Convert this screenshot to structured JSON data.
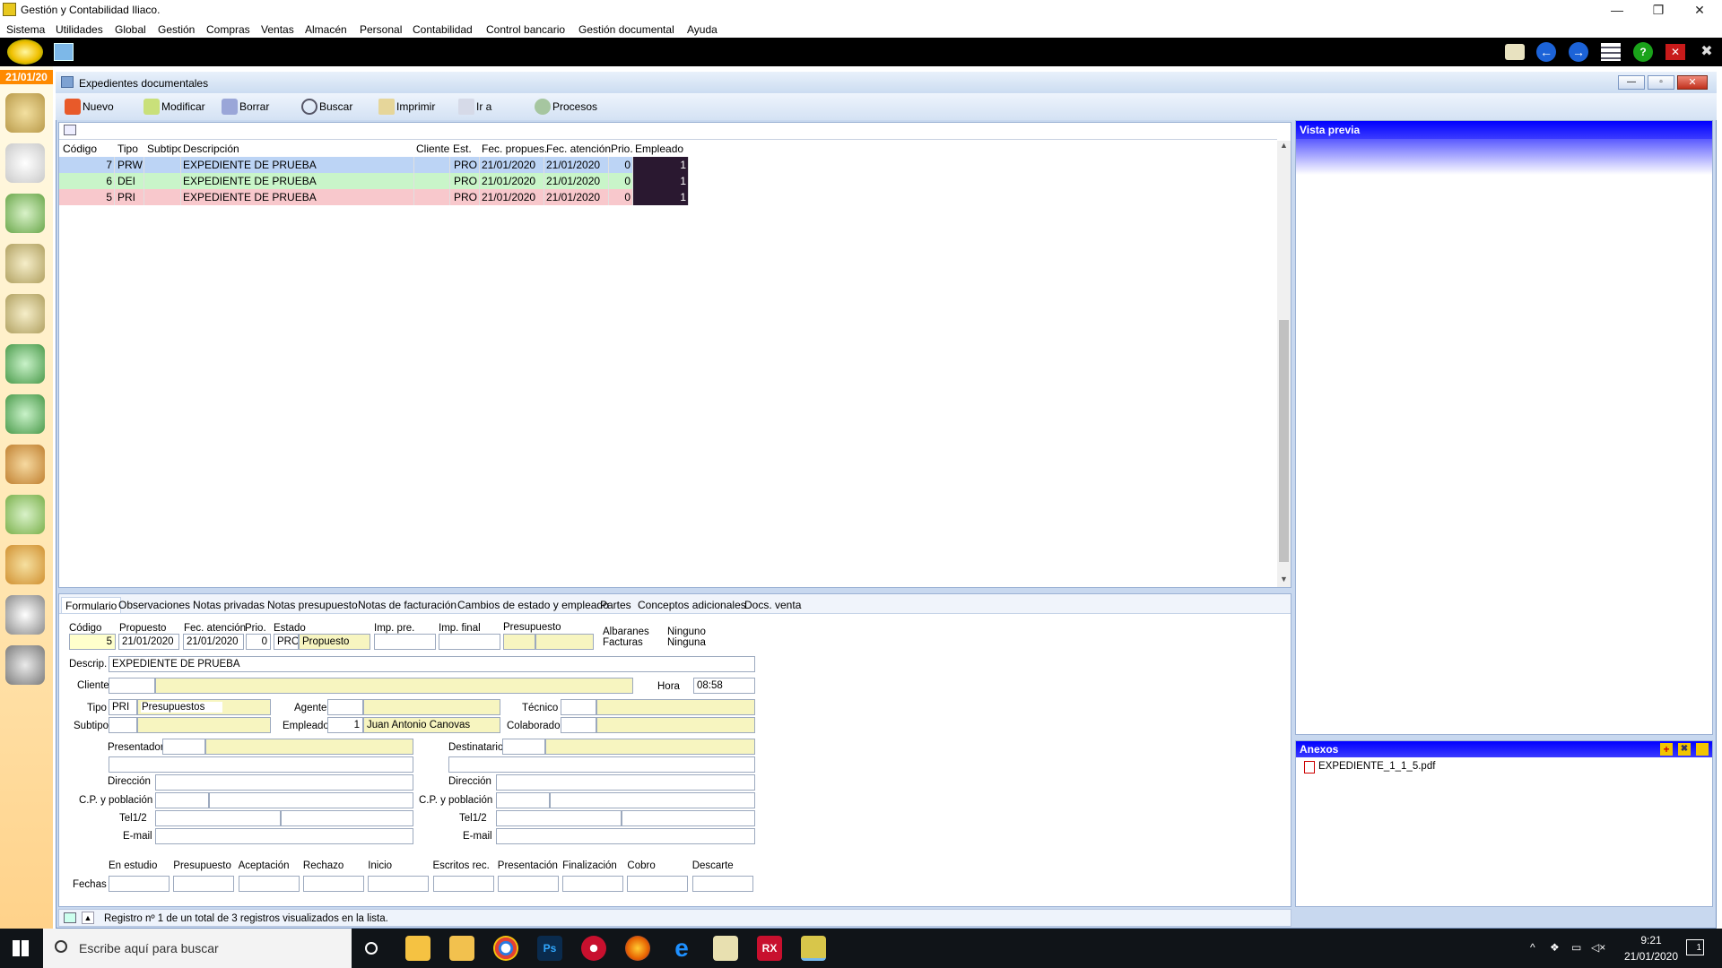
{
  "app": {
    "title": "Gestión y Contabilidad Iliaco.",
    "date_chip": "21/01/20",
    "menu": [
      "Sistema",
      "Utilidades",
      "Global",
      "Gestión",
      "Compras",
      "Ventas",
      "Almacén",
      "Personal",
      "Contabilidad",
      "Control bancario",
      "Gestión documental",
      "Ayuda"
    ]
  },
  "window": {
    "title": "Expedientes documentales",
    "toolbar": [
      "Nuevo",
      "Modificar",
      "Borrar",
      "Buscar",
      "Imprimir",
      "Ir a",
      "Procesos"
    ]
  },
  "grid": {
    "headers": [
      "Código",
      "Tipo",
      "Subtipo",
      "Descripción",
      "Cliente",
      "Est.",
      "Fec. propues.",
      "Fec. atención",
      "Prio.",
      "Empleado"
    ],
    "rows": [
      {
        "codigo": "7",
        "tipo": "PRW",
        "subtipo": "",
        "descripcion": "EXPEDIENTE DE PRUEBA",
        "cliente": "",
        "est": "PRO",
        "fec_prop": "21/01/2020",
        "fec_aten": "21/01/2020",
        "prio": "0",
        "empleado": "1",
        "color": "#bcd4f5"
      },
      {
        "codigo": "6",
        "tipo": "DEI",
        "subtipo": "",
        "descripcion": "EXPEDIENTE DE PRUEBA",
        "cliente": "",
        "est": "PRO",
        "fec_prop": "21/01/2020",
        "fec_aten": "21/01/2020",
        "prio": "0",
        "empleado": "1",
        "color": "#c9f5c9"
      },
      {
        "codigo": "5",
        "tipo": "PRI",
        "subtipo": "",
        "descripcion": "EXPEDIENTE DE PRUEBA",
        "cliente": "",
        "est": "PRO",
        "fec_prop": "21/01/2020",
        "fec_aten": "21/01/2020",
        "prio": "0",
        "empleado": "1",
        "color": "#f8c8cc"
      }
    ]
  },
  "preview": {
    "title": "Vista previa"
  },
  "anexos": {
    "title": "Anexos",
    "files": [
      "EXPEDIENTE_1_1_5.pdf"
    ]
  },
  "tabs": [
    "Formulario",
    "Observaciones",
    "Notas privadas",
    "Notas presupuesto",
    "Notas de facturación",
    "Cambios de estado y empleado",
    "Partes",
    "Conceptos adicionales",
    "Docs. venta"
  ],
  "form": {
    "l_codigo": "Código",
    "l_propuesto": "Propuesto",
    "l_fec_aten": "Fec. atención",
    "l_prio": "Prio.",
    "l_estado": "Estado",
    "l_imp_pre": "Imp. pre.",
    "l_imp_final": "Imp. final",
    "l_presupuesto": "Presupuesto",
    "l_albaranes": "Albaranes",
    "l_facturas": "Facturas",
    "albaranes": "Ninguno",
    "facturas": "Ninguna",
    "codigo": "5",
    "propuesto": "21/01/2020",
    "fec_aten": "21/01/2020",
    "prio": "0",
    "estado_code": "PRO",
    "estado": "Propuesto",
    "l_descrip": "Descrip.",
    "descrip": "EXPEDIENTE DE PRUEBA",
    "l_cliente": "Cliente",
    "l_hora": "Hora",
    "hora": "08:58",
    "l_tipo": "Tipo",
    "tipo_code": "PRI",
    "tipo": "Presupuestos",
    "l_agente": "Agente",
    "l_tecnico": "Técnico",
    "l_subtipo": "Subtipo",
    "l_empleado": "Empleado",
    "empleado_code": "1",
    "empleado": "Juan Antonio Canovas",
    "l_colaborador": "Colaborador",
    "l_presentador": "Presentador",
    "l_destinatario": "Destinatario",
    "l_direccion": "Dirección",
    "l_cp": "C.P. y población",
    "l_tel": "Tel1/2",
    "l_email": "E-mail",
    "l_fechas": "Fechas",
    "fechas": [
      "En estudio",
      "Presupuesto",
      "Aceptación",
      "Rechazo",
      "Inicio",
      "Escritos rec.",
      "Presentación",
      "Finalización",
      "Cobro",
      "Descarte"
    ]
  },
  "status": "Registro nº 1 de un total de 3 registros visualizados en la lista.",
  "taskbar": {
    "search_placeholder": "Escribe aquí para buscar",
    "time": "9:21",
    "date": "21/01/2020",
    "notif": "1"
  }
}
